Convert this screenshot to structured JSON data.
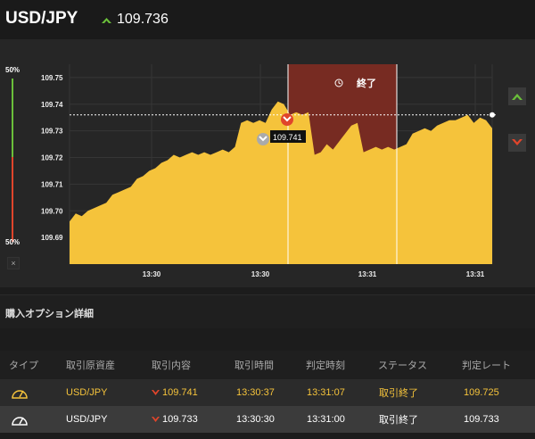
{
  "header": {
    "pair": "USD/JPY",
    "current_rate": "109.736",
    "trend": "up-arrow-icon"
  },
  "chart": {
    "gauge_top_label": "50%",
    "gauge_bottom_label": "50%",
    "gauge_close": "×",
    "period_label": "終了",
    "marker_label": "109.741",
    "up_button": "up-arrow-icon",
    "down_button": "down-arrow-icon",
    "colors": {
      "area": "#f5c33b",
      "period": "#7b2b22",
      "up": "#6abf3a",
      "down": "#e0452b"
    }
  },
  "chart_data": {
    "type": "area",
    "y_ticks": [
      "109.75",
      "109.74",
      "109.73",
      "109.72",
      "109.71",
      "109.70",
      "109.69"
    ],
    "x_ticks": [
      "13:30",
      "13:30",
      "13:31",
      "13:31"
    ],
    "ylim": [
      109.68,
      109.755
    ],
    "current_line": 109.736,
    "grid": true,
    "series": [
      {
        "values": [
          109.696,
          109.699,
          109.698,
          109.7,
          109.701,
          109.702,
          109.703,
          109.706,
          109.707,
          109.708,
          109.709,
          109.712,
          109.713,
          109.715,
          109.716,
          109.718,
          109.719,
          109.721,
          109.72,
          109.721,
          109.722,
          109.721,
          109.722,
          109.721,
          109.722,
          109.723,
          109.722,
          109.724,
          109.733,
          109.734,
          109.733,
          109.734,
          109.733,
          109.738,
          109.741,
          109.74,
          109.736,
          109.737,
          109.736,
          109.737,
          109.721,
          109.722,
          109.725,
          109.723,
          109.726,
          109.729,
          109.732,
          109.733,
          109.722,
          109.723,
          109.724,
          109.723,
          109.724,
          109.723,
          109.724,
          109.725,
          109.729,
          109.73,
          109.731,
          109.73,
          109.732,
          109.733,
          109.734,
          109.734,
          109.735,
          109.736,
          109.733,
          109.735,
          109.734,
          109.731
        ]
      }
    ]
  },
  "details": {
    "title": "購入オプション詳細",
    "headers": [
      "タイプ",
      "取引原資産",
      "取引内容",
      "取引時間",
      "判定時刻",
      "ステータス",
      "判定レート"
    ],
    "rows": [
      {
        "type_icon": "gauge-icon",
        "asset": "USD/JPY",
        "content_icon": "down-arrow-icon",
        "content": "109.741",
        "trade_time": "13:30:37",
        "judge_time": "13:31:07",
        "status": "取引終了",
        "judge_rate": "109.725"
      },
      {
        "type_icon": "gauge-icon",
        "asset": "USD/JPY",
        "content_icon": "down-arrow-icon",
        "content": "109.733",
        "trade_time": "13:30:30",
        "judge_time": "13:31:00",
        "status": "取引終了",
        "judge_rate": "109.733"
      }
    ]
  }
}
